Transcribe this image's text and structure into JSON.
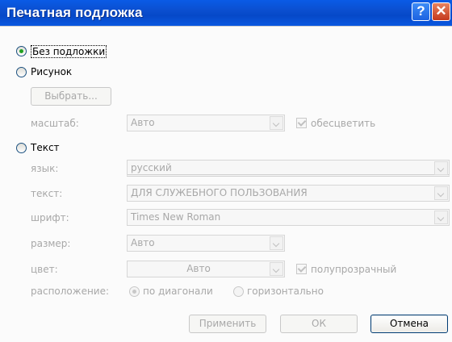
{
  "window": {
    "title": "Печатная подложка"
  },
  "options": {
    "none_label": "Без подложки",
    "picture_label": "Рисунок",
    "text_label": "Текст"
  },
  "picture": {
    "select_button": "Выбрать...",
    "scale_label": "масштаб:",
    "scale_value": "Авто",
    "washout_label": "обесцветить"
  },
  "text": {
    "language_label": "язык:",
    "language_value": "русский",
    "text_label": "текст:",
    "text_value": "ДЛЯ СЛУЖЕБНОГО ПОЛЬЗОВАНИЯ",
    "font_label": "шрифт:",
    "font_value": "Times New Roman",
    "size_label": "размер:",
    "size_value": "Авто",
    "color_label": "цвет:",
    "color_value": "Авто",
    "semitransparent_label": "полупрозрачный",
    "layout_label": "расположение:",
    "diagonal_label": "по диагонали",
    "horizontal_label": "горизонтально"
  },
  "buttons": {
    "apply": "Применить",
    "ok": "ОК",
    "cancel": "Отмена"
  }
}
